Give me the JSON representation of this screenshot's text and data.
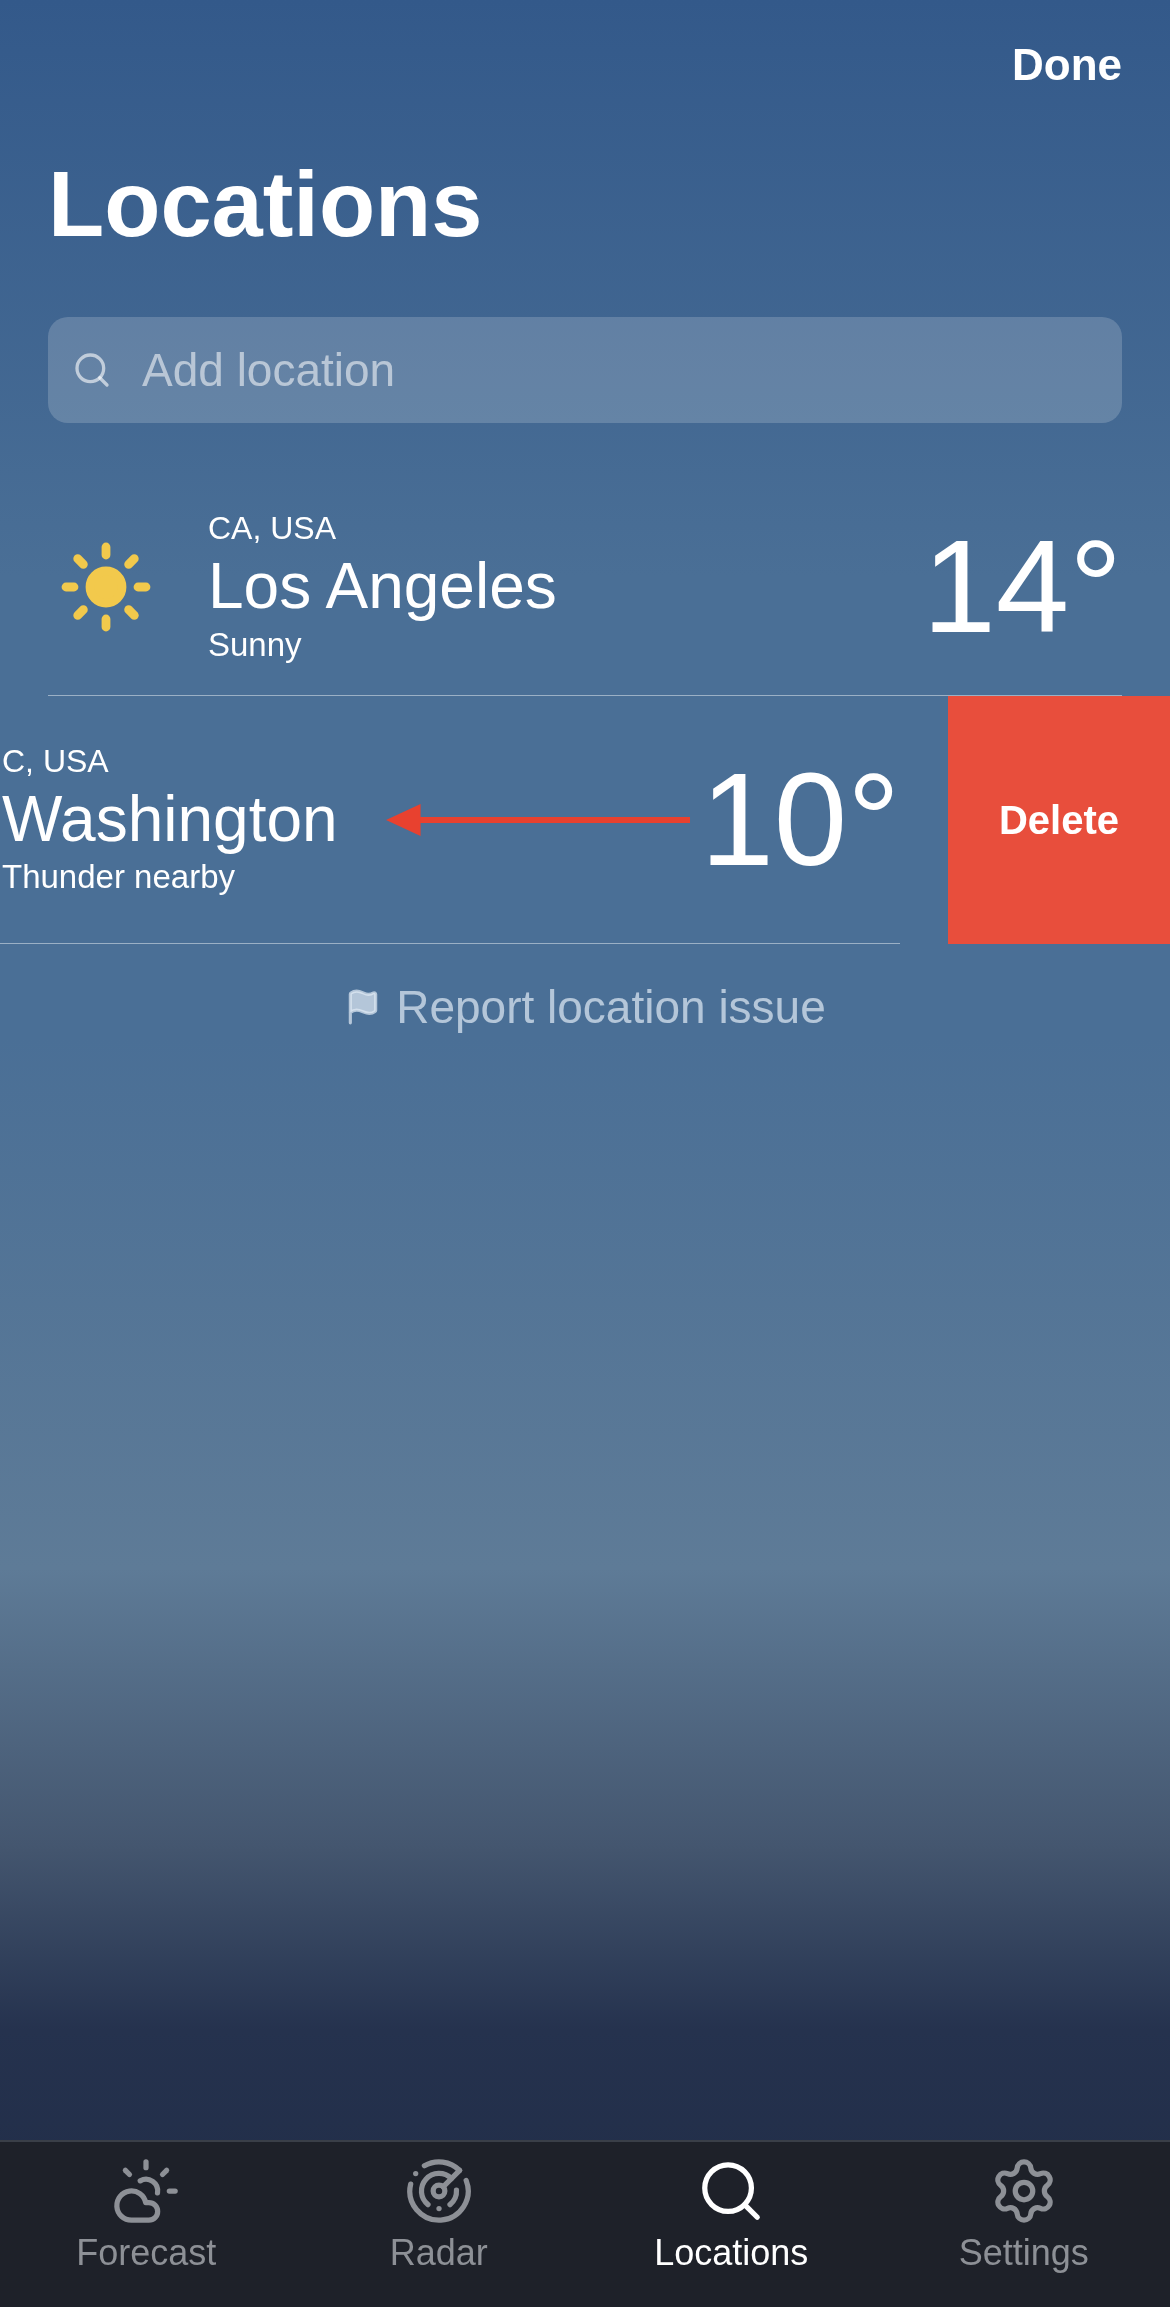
{
  "header": {
    "done_button": "Done",
    "title": "Locations"
  },
  "search": {
    "placeholder": "Add location"
  },
  "locations": [
    {
      "region": "CA, USA",
      "city": "Los Angeles",
      "condition": "Sunny",
      "temperature": "14°",
      "swiped": false
    },
    {
      "region": "C, USA",
      "city": "Washington",
      "condition": "Thunder nearby",
      "temperature": "10°",
      "swiped": true,
      "action": "Delete"
    }
  ],
  "report_link": "Report location issue",
  "tabs": [
    {
      "kind": "forecast",
      "label": "Forecast",
      "selected": false
    },
    {
      "kind": "radar",
      "label": "Radar",
      "selected": false
    },
    {
      "kind": "locations",
      "label": "Locations",
      "selected": true
    },
    {
      "kind": "settings",
      "label": "Settings",
      "selected": false
    }
  ]
}
